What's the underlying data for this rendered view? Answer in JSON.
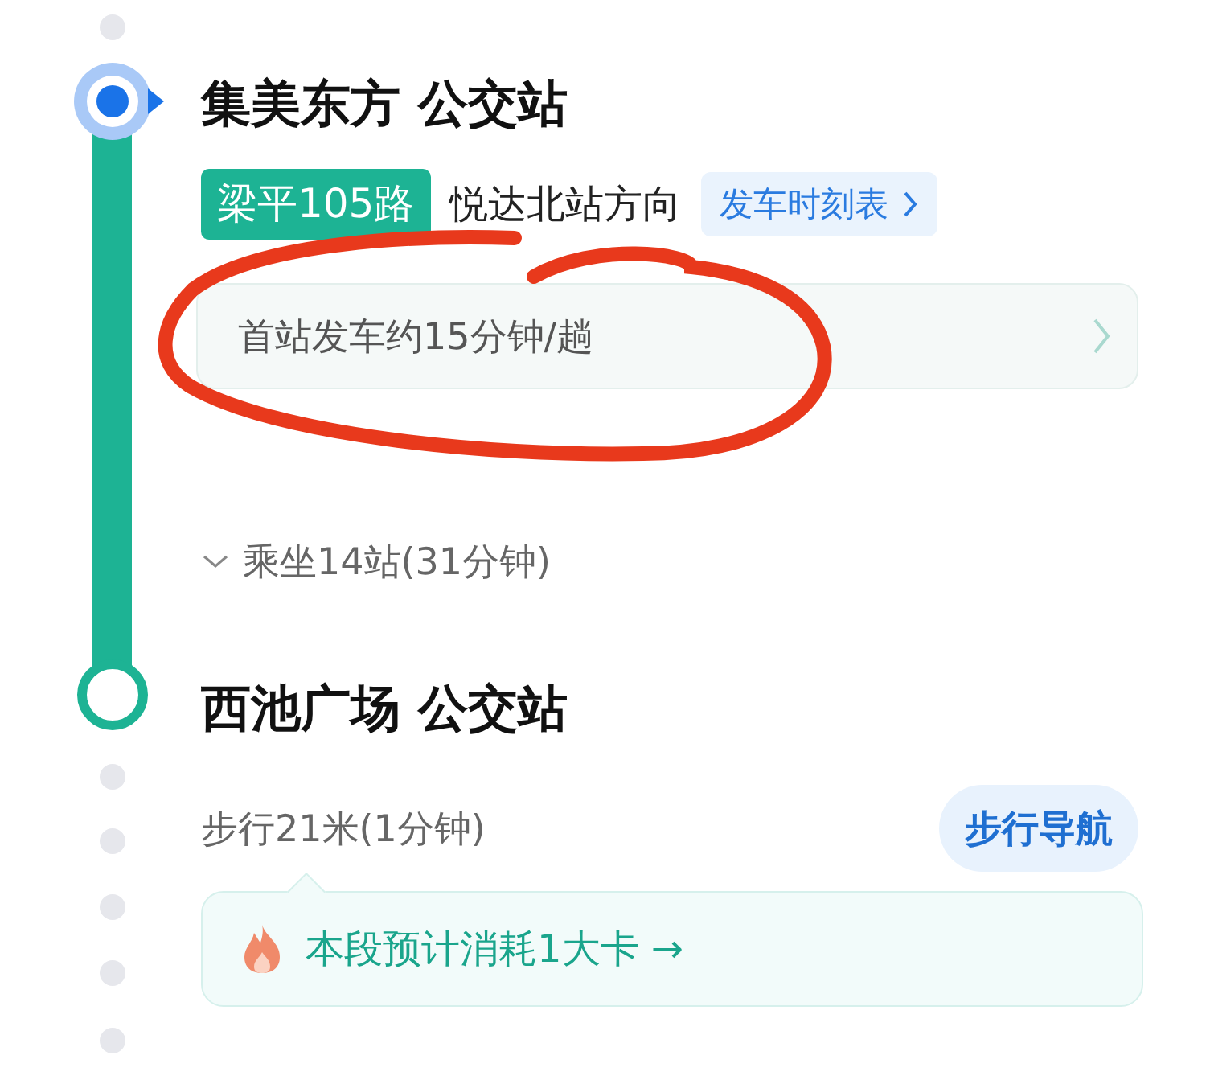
{
  "origin": {
    "name": "集美东方 公交站"
  },
  "line": {
    "badge": "梁平105路",
    "direction": "悦达北站方向",
    "timetable_button": "发车时刻表"
  },
  "info_card": {
    "text": "首站发车约15分钟/趟"
  },
  "ride": {
    "text": "乘坐14站(31分钟)",
    "expanded": false
  },
  "destination": {
    "name": "西池广场 公交站"
  },
  "walk": {
    "text": "步行21米(1分钟)",
    "nav_button": "步行导航"
  },
  "calorie": {
    "text": "本段预计消耗1大卡 →"
  },
  "annotation": {
    "kind": "freehand-circle"
  }
}
